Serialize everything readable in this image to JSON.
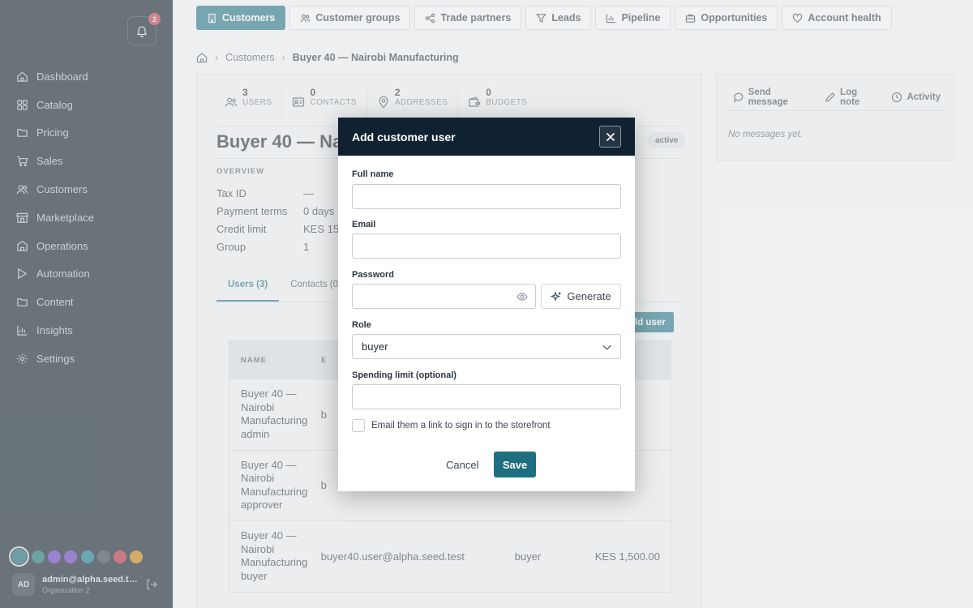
{
  "notifications": {
    "count": "2"
  },
  "sidebar": {
    "items": [
      {
        "label": "Dashboard",
        "icon": "home-icon"
      },
      {
        "label": "Catalog",
        "icon": "grid-icon"
      },
      {
        "label": "Pricing",
        "icon": "folder-icon"
      },
      {
        "label": "Sales",
        "icon": "cart-icon"
      },
      {
        "label": "Customers",
        "icon": "users-icon"
      },
      {
        "label": "Marketplace",
        "icon": "store-icon"
      },
      {
        "label": "Operations",
        "icon": "building-icon"
      },
      {
        "label": "Automation",
        "icon": "flow-icon"
      },
      {
        "label": "Content",
        "icon": "folder-icon"
      },
      {
        "label": "Insights",
        "icon": "chart-icon"
      },
      {
        "label": "Settings",
        "icon": "gear-icon"
      }
    ],
    "theme_colors": [
      "#1e6f80",
      "#167a7e",
      "#6d3fd4",
      "#6a3fc8",
      "#138597",
      "#3a4a55",
      "#c92c3c",
      "#d88a0a"
    ],
    "user": {
      "initials": "AD",
      "email": "admin@alpha.seed.test",
      "org": "Organization 2"
    }
  },
  "top_tabs": [
    {
      "label": "Customers",
      "icon": "building-icon",
      "active": true
    },
    {
      "label": "Customer groups",
      "icon": "users-icon"
    },
    {
      "label": "Trade partners",
      "icon": "share-icon"
    },
    {
      "label": "Leads",
      "icon": "filter-icon"
    },
    {
      "label": "Pipeline",
      "icon": "chart-icon"
    },
    {
      "label": "Opportunities",
      "icon": "briefcase-icon"
    },
    {
      "label": "Account health",
      "icon": "heart-icon"
    }
  ],
  "breadcrumb": {
    "parent": "Customers",
    "current": "Buyer 40 — Nairobi Manufacturing"
  },
  "stats": [
    {
      "value": "3",
      "label": "USERS"
    },
    {
      "value": "0",
      "label": "CONTACTS"
    },
    {
      "value": "2",
      "label": "ADDRESSES"
    },
    {
      "value": "0",
      "label": "BUDGETS"
    }
  ],
  "customer": {
    "title": "Buyer 40 — Nai",
    "status": "active",
    "overview_label": "OVERVIEW",
    "overview": [
      {
        "key": "Tax ID",
        "value": "—"
      },
      {
        "key": "Payment terms",
        "value": "0 days"
      },
      {
        "key": "Credit limit",
        "value": "KES 15"
      },
      {
        "key": "Group",
        "value": "1"
      }
    ]
  },
  "subtabs": {
    "users": "Users (3)",
    "contacts": "Contacts (0"
  },
  "add_user_label": "ld user",
  "table": {
    "headers": {
      "name": "NAME",
      "email": "E"
    },
    "rows": [
      {
        "name": "Buyer 40 — Nairobi Manufacturing admin",
        "email": "b",
        "role": "",
        "limit": ""
      },
      {
        "name": "Buyer 40 — Nairobi Manufacturing approver",
        "email": "b",
        "role": "",
        "limit": ""
      },
      {
        "name": "Buyer 40 — Nairobi Manufacturing buyer",
        "email": "buyer40.user@alpha.seed.test",
        "role": "buyer",
        "limit": "KES 1,500.00"
      }
    ]
  },
  "side_panel": {
    "send_message": "Send message",
    "log_note": "Log note",
    "activity": "Activity",
    "empty": "No messages yet."
  },
  "modal": {
    "title": "Add customer user",
    "full_name_label": "Full name",
    "full_name_value": "",
    "email_label": "Email",
    "email_value": "",
    "password_label": "Password",
    "password_value": "",
    "generate_label": "Generate",
    "role_label": "Role",
    "role_value": "buyer",
    "spending_label": "Spending limit (optional)",
    "spending_value": "",
    "email_link_label": "Email them a link to sign in to the storefront",
    "cancel_label": "Cancel",
    "save_label": "Save"
  }
}
